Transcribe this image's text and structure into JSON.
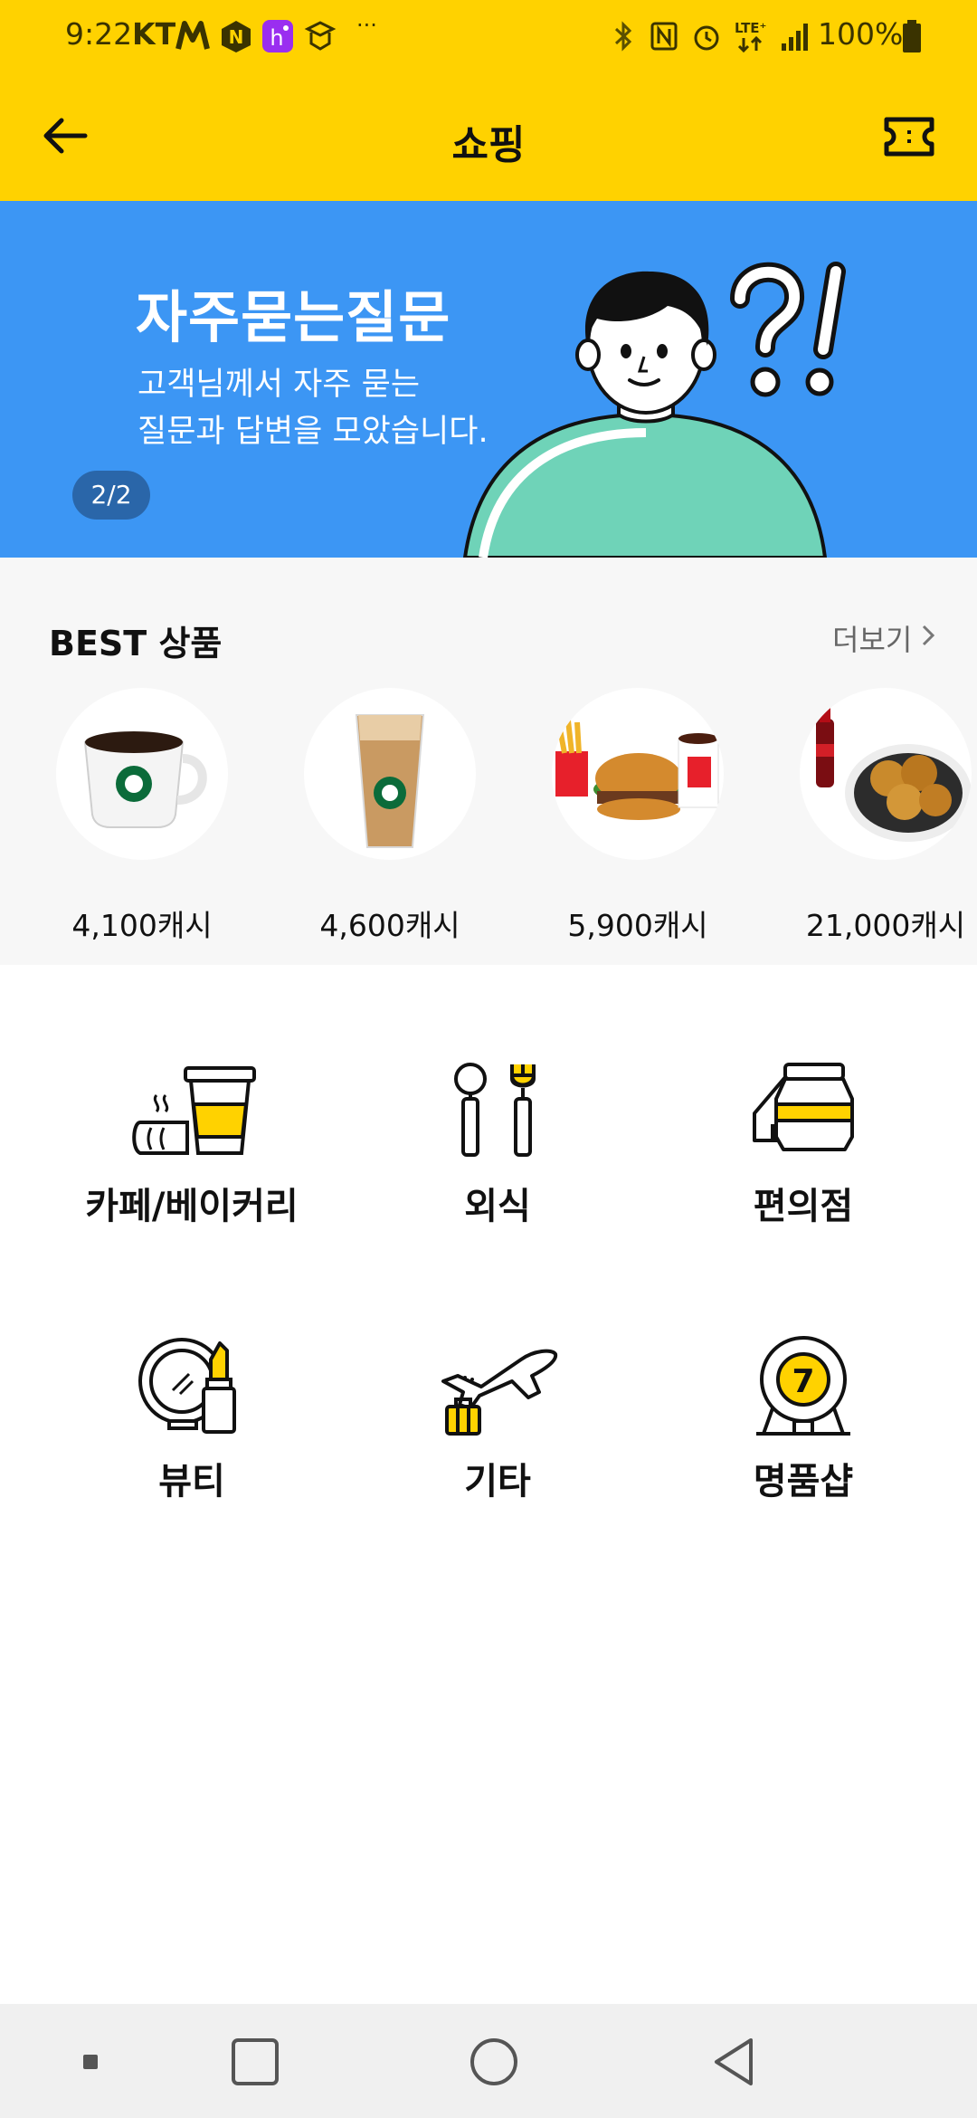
{
  "status_bar": {
    "time": "9:22",
    "carrier": "KT",
    "battery": "100%"
  },
  "app_bar": {
    "title": "쇼핑"
  },
  "banner": {
    "title": "자주묻는질문",
    "subtitle_line1": "고객님께서 자주 묻는",
    "subtitle_line2": "질문과 답변을 모았습니다.",
    "pager": "2/2"
  },
  "best": {
    "title": "BEST 상품",
    "more_label": "더보기",
    "products": [
      {
        "price": "4,100캐시"
      },
      {
        "price": "4,600캐시"
      },
      {
        "price": "5,900캐시"
      },
      {
        "price": "21,000캐시"
      }
    ]
  },
  "categories": [
    {
      "label": "카페/베이커리",
      "icon": "cafe-bakery-icon"
    },
    {
      "label": "외식",
      "icon": "dining-icon"
    },
    {
      "label": "편의점",
      "icon": "convenience-store-icon"
    },
    {
      "label": "뷰티",
      "icon": "beauty-icon"
    },
    {
      "label": "기타",
      "icon": "travel-icon"
    },
    {
      "label": "명품샵",
      "icon": "luxury-shop-icon"
    }
  ],
  "colors": {
    "accent": "#ffd200",
    "banner_bg": "#3c96f4",
    "icon_yellow": "#ffd200",
    "mint": "#6fd3b8"
  }
}
